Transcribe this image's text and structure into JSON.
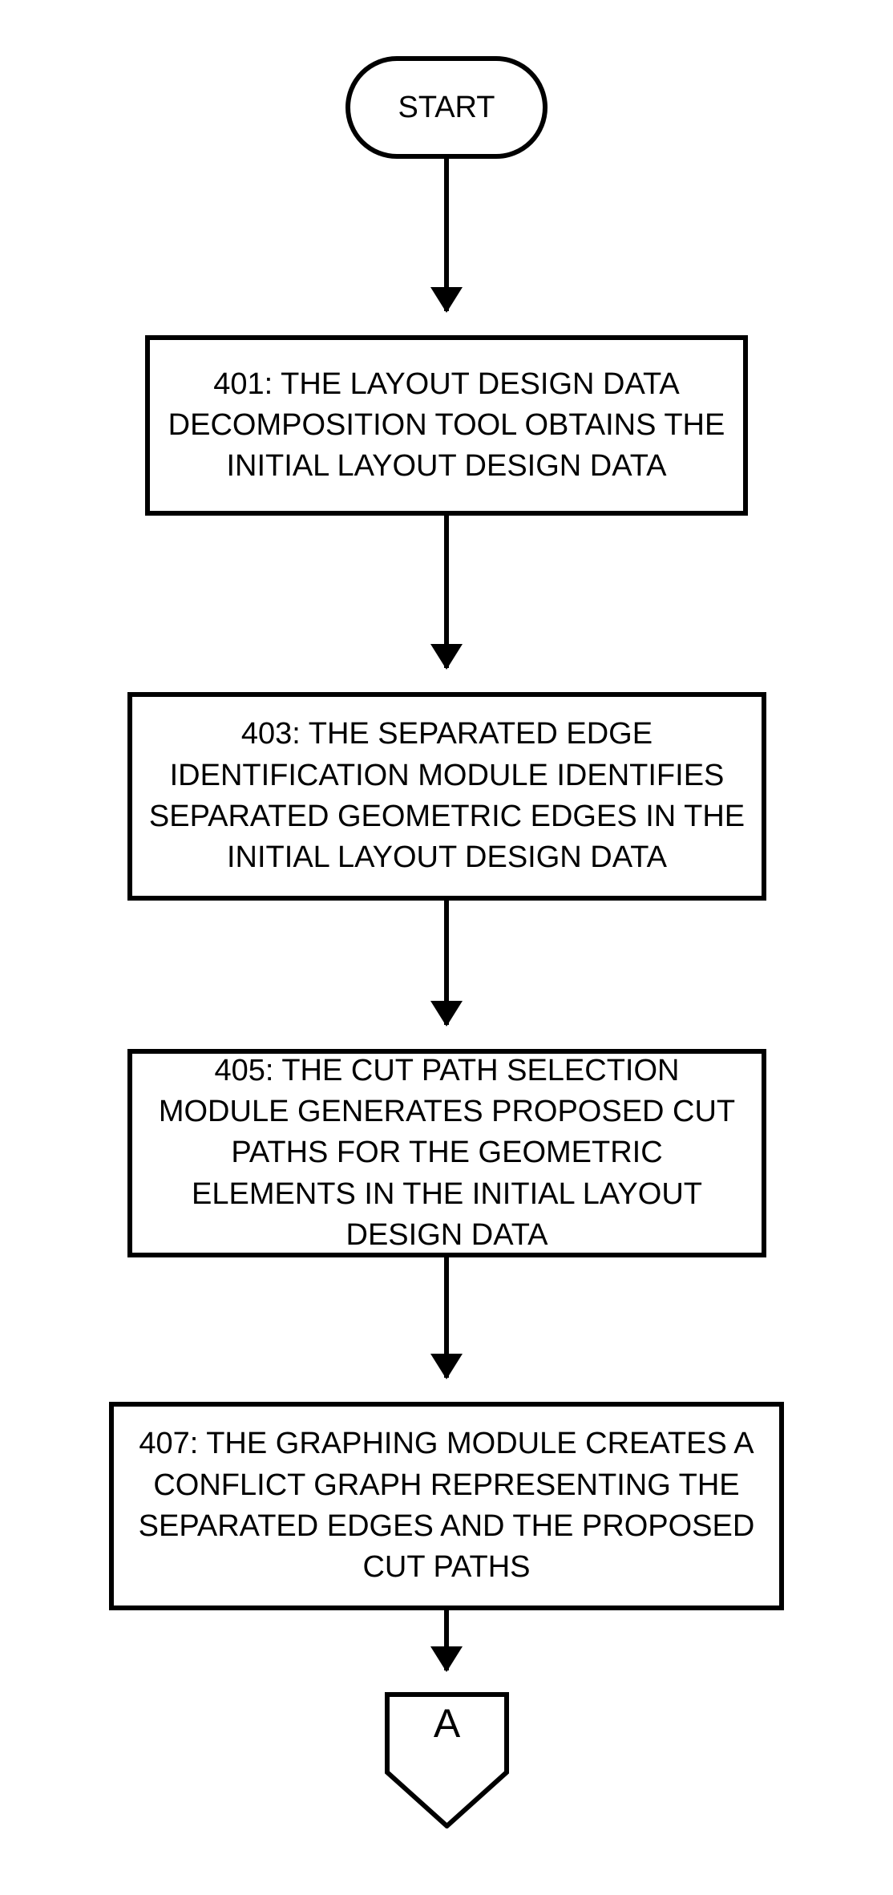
{
  "start": {
    "label": "START"
  },
  "steps": [
    {
      "text": "401: THE LAYOUT DESIGN DATA DECOMPOSITION TOOL OBTAINS THE INITIAL LAYOUT DESIGN DATA"
    },
    {
      "text": "403: THE SEPARATED EDGE IDENTIFICATION MODULE IDENTIFIES SEPARATED GEOMETRIC EDGES IN THE INITIAL LAYOUT DESIGN DATA"
    },
    {
      "text": "405: THE CUT PATH SELECTION MODULE GENERATES PROPOSED CUT PATHS FOR THE GEOMETRIC ELEMENTS IN THE INITIAL LAYOUT DESIGN DATA"
    },
    {
      "text": "407: THE GRAPHING MODULE CREATES A CONFLICT GRAPH REPRESENTING THE SEPARATED EDGES AND THE PROPOSED CUT PATHS"
    }
  ],
  "connector": {
    "label": "A"
  }
}
